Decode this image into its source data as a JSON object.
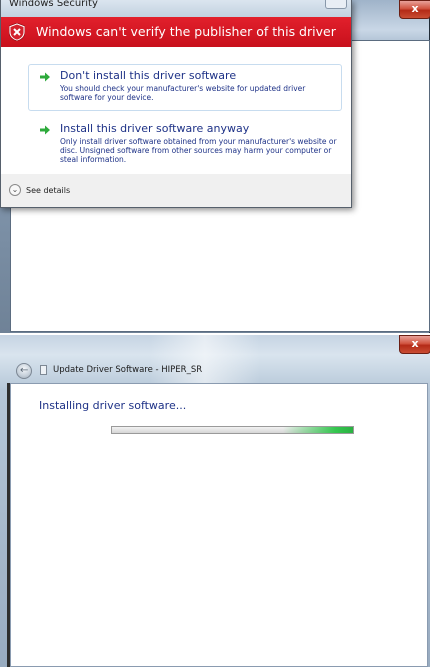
{
  "top_window": {
    "close_label": "x"
  },
  "security_dialog": {
    "title": "Windows Security",
    "header": "Windows can't verify the publisher of this driver software",
    "options": [
      {
        "title": "Don't install this driver software",
        "description": "You should check your manufacturer's website for updated driver software for your device."
      },
      {
        "title": "Install this driver software anyway",
        "description": "Only install driver software obtained from your manufacturer's website or disc. Unsigned software from other sources may harm your computer or steal information."
      }
    ],
    "details_label": "See details",
    "colors": {
      "header_red": "#d7141e",
      "link_blue": "#1e3287"
    }
  },
  "update_window": {
    "title": "Update Driver Software - HIPER_SR",
    "close_label": "x",
    "heading": "Installing driver software...",
    "progress": {
      "state": "indeterminate",
      "color": "#35c64f"
    }
  }
}
